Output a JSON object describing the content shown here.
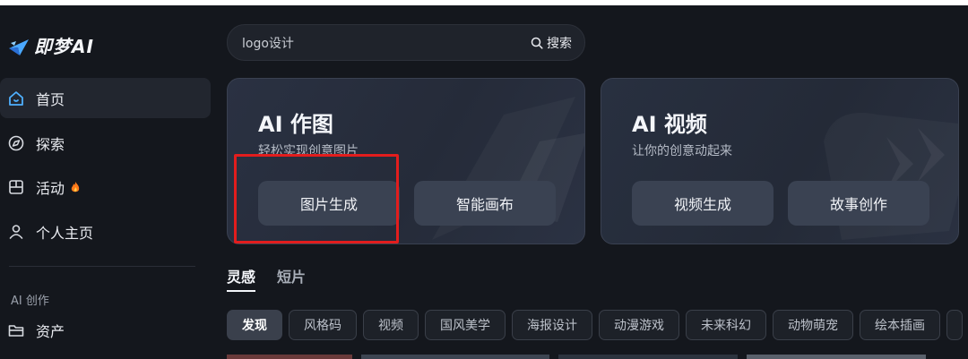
{
  "app": {
    "name": "即梦AI"
  },
  "sidebar": {
    "items": [
      {
        "label": "首页",
        "icon": "home-icon"
      },
      {
        "label": "探索",
        "icon": "compass-icon"
      },
      {
        "label": "活动",
        "icon": "event-icon",
        "badge": "fire-icon"
      },
      {
        "label": "个人主页",
        "icon": "user-icon"
      }
    ],
    "section_label": "AI 创作",
    "section_items": [
      {
        "label": "资产",
        "icon": "folder-icon"
      }
    ]
  },
  "search": {
    "value": "logo设计",
    "button_label": "搜索"
  },
  "cards": [
    {
      "title": "AI 作图",
      "subtitle": "轻松实现创意图片",
      "buttons": [
        "图片生成",
        "智能画布"
      ]
    },
    {
      "title": "AI 视频",
      "subtitle": "让你的创意动起来",
      "buttons": [
        "视频生成",
        "故事创作"
      ]
    }
  ],
  "tabs": [
    {
      "label": "灵感",
      "active": true
    },
    {
      "label": "短片",
      "active": false
    }
  ],
  "chips": [
    "发现",
    "风格码",
    "视频",
    "国风美学",
    "海报设计",
    "动漫游戏",
    "未来科幻",
    "动物萌宠",
    "绘本插画"
  ],
  "colors": {
    "background": "#14171d",
    "card_button": "#3a4252",
    "highlight_box": "#e21d1d",
    "fire": "#ff7a1a"
  }
}
